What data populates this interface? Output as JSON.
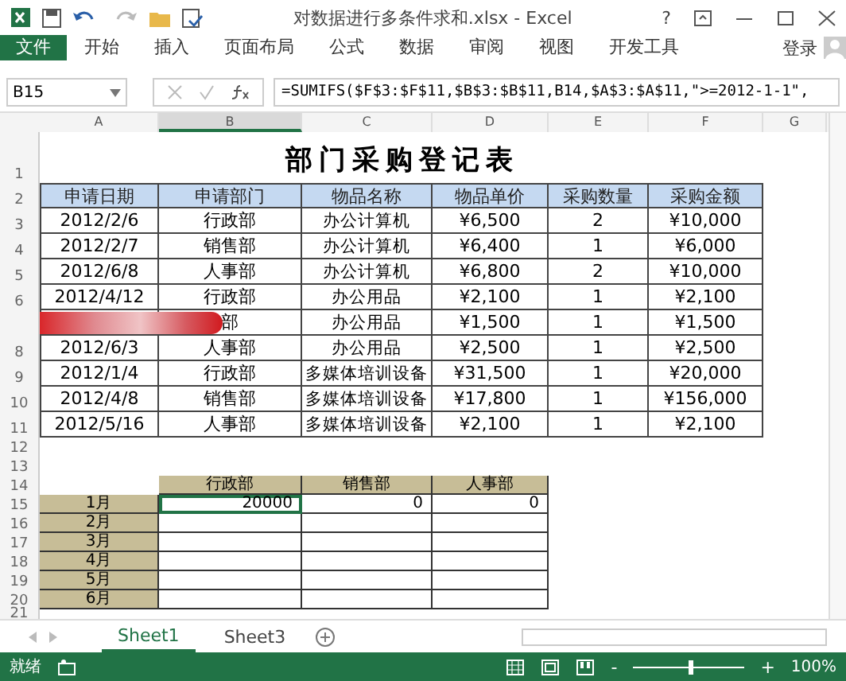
{
  "window": {
    "title": "对数据进行多条件求和.xlsx - Excel",
    "help": "?"
  },
  "ribbon": {
    "tabs": [
      {
        "label": "文件",
        "kind": "file",
        "selected": false
      },
      {
        "label": "开始",
        "kind": "tab",
        "selected": false
      },
      {
        "label": "插入",
        "kind": "tab",
        "selected": false
      },
      {
        "label": "页面布局",
        "kind": "tab",
        "selected": false
      },
      {
        "label": "公式",
        "kind": "tab",
        "selected": false
      },
      {
        "label": "数据",
        "kind": "tab",
        "selected": false
      },
      {
        "label": "审阅",
        "kind": "tab",
        "selected": false
      },
      {
        "label": "视图",
        "kind": "tab",
        "selected": false
      },
      {
        "label": "开发工具",
        "kind": "tab",
        "selected": false
      }
    ],
    "signin": "登录"
  },
  "formula_bar": {
    "name_box": "B15",
    "formula": "=SUMIFS($F$3:$F$11,$B$3:$B$11,B14,$A$3:$A$11,\">=2012-1-1\","
  },
  "sheet": {
    "columns": [
      {
        "label": "A",
        "selected": false
      },
      {
        "label": "B",
        "selected": true
      },
      {
        "label": "C",
        "selected": false
      },
      {
        "label": "D",
        "selected": false
      },
      {
        "label": "E",
        "selected": false
      },
      {
        "label": "F",
        "selected": false
      },
      {
        "label": "G",
        "selected": false
      }
    ],
    "row_numbers": [
      "1",
      "2",
      "3",
      "4",
      "5",
      "6",
      "8",
      "9",
      "10",
      "11",
      "12",
      "13",
      "14",
      "15",
      "16",
      "17",
      "18",
      "19",
      "20",
      "21"
    ],
    "title": "部门采购登记表",
    "headers": [
      "申请日期",
      "申请部门",
      "物品名称",
      "物品单价",
      "采购数量",
      "采购金额"
    ],
    "rows": [
      {
        "cells": [
          "2012/2/6",
          "行政部",
          "办公计算机",
          "¥6,500",
          "2",
          "¥10,000"
        ]
      },
      {
        "cells": [
          "2012/2/7",
          "销售部",
          "办公计算机",
          "¥6,400",
          "1",
          "¥6,000"
        ]
      },
      {
        "cells": [
          "2012/6/8",
          "人事部",
          "办公计算机",
          "¥6,800",
          "2",
          "¥10,000"
        ]
      },
      {
        "cells": [
          "2012/4/12",
          "行政部",
          "办公用品",
          "¥2,100",
          "1",
          "¥2,100"
        ]
      },
      {
        "cells": [
          null,
          "部",
          "办公用品",
          "¥1,500",
          "1",
          "¥1,500"
        ],
        "obscured": true
      },
      {
        "cells": [
          "2012/6/3",
          "人事部",
          "办公用品",
          "¥2,500",
          "1",
          "¥2,500"
        ]
      },
      {
        "cells": [
          "2012/1/4",
          "行政部",
          "多媒体培训设备",
          "¥31,500",
          "1",
          "¥20,000"
        ]
      },
      {
        "cells": [
          "2012/4/8",
          "销售部",
          "多媒体培训设备",
          "¥17,800",
          "1",
          "¥156,000"
        ]
      },
      {
        "cells": [
          "2012/5/16",
          "人事部",
          "多媒体培训设备",
          "¥2,100",
          "1",
          "¥2,100"
        ]
      }
    ],
    "summary": {
      "departments": [
        "行政部",
        "销售部",
        "人事部"
      ],
      "months": [
        {
          "label": "1月",
          "values": [
            {
              "text": "20000",
              "active": true
            },
            {
              "text": "0",
              "active": false
            },
            {
              "text": "0",
              "active": false
            }
          ]
        },
        {
          "label": "2月"
        },
        {
          "label": "3月"
        },
        {
          "label": "4月"
        },
        {
          "label": "5月"
        },
        {
          "label": "6月"
        }
      ]
    }
  },
  "sheet_tabs": [
    {
      "label": "Sheet1",
      "selected": true
    },
    {
      "label": "Sheet3",
      "selected": false
    }
  ],
  "status_bar": {
    "status": "就绪",
    "zoom_out": "-",
    "zoom_in": "+",
    "zoom": "100%",
    "zoom_slider": {
      "level": 0.5
    }
  }
}
